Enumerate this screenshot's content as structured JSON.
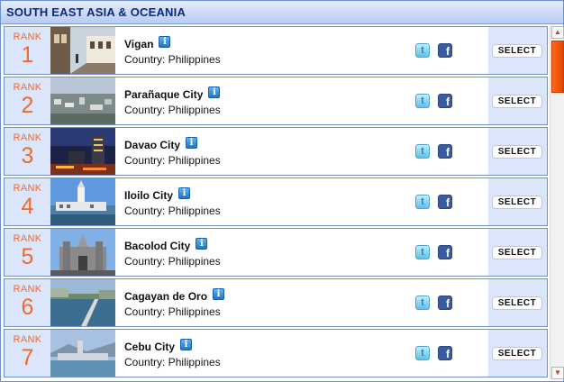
{
  "header": {
    "title": "SOUTH EAST ASIA & OCEANIA"
  },
  "rank_label": "RANK",
  "select_label": "SELECT",
  "icons": {
    "info": "info-icon",
    "twitter": "twitter-icon",
    "facebook": "facebook-icon"
  },
  "colors": {
    "accent_rank": "#ef6a2a",
    "header_text": "#0a2a80",
    "row_bg": "#dce6fb",
    "scroll_thumb": "#ff6a1a"
  },
  "rows": [
    {
      "rank": "1",
      "city": "Vigan",
      "country": "Country: Philippines"
    },
    {
      "rank": "2",
      "city": "Parañaque City",
      "country": "Country: Philippines"
    },
    {
      "rank": "3",
      "city": "Davao City",
      "country": "Country: Philippines"
    },
    {
      "rank": "4",
      "city": "Iloilo City",
      "country": "Country: Philippines"
    },
    {
      "rank": "5",
      "city": "Bacolod City",
      "country": "Country: Philippines"
    },
    {
      "rank": "6",
      "city": "Cagayan de Oro",
      "country": "Country: Philippines"
    },
    {
      "rank": "7",
      "city": "Cebu City",
      "country": "Country: Philippines"
    }
  ]
}
